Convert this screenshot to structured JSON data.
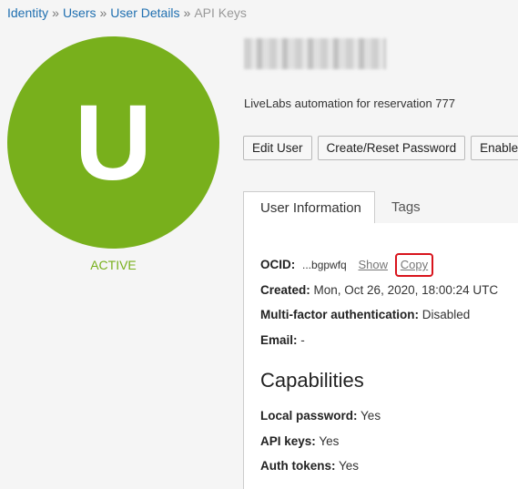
{
  "breadcrumb": {
    "items": [
      "Identity",
      "Users",
      "User Details"
    ],
    "current": "API Keys",
    "separator": "»"
  },
  "user": {
    "initial": "U",
    "status": "ACTIVE",
    "description": "LiveLabs automation for reservation 777"
  },
  "actions": {
    "edit_user": "Edit User",
    "reset_password": "Create/Reset Password",
    "enable": "Enable M"
  },
  "tabs": {
    "user_information": "User Information",
    "tags": "Tags"
  },
  "info": {
    "ocid_label": "OCID:",
    "ocid_value": "...bgpwfq",
    "show_link": "Show",
    "copy_link": "Copy",
    "created_label": "Created:",
    "created_value": "Mon, Oct 26, 2020, 18:00:24 UTC",
    "mfa_label": "Multi-factor authentication:",
    "mfa_value": "Disabled",
    "email_label": "Email:",
    "email_value": "-"
  },
  "capabilities": {
    "title": "Capabilities",
    "local_password_label": "Local password:",
    "local_password_value": "Yes",
    "api_keys_label": "API keys:",
    "api_keys_value": "Yes",
    "auth_tokens_label": "Auth tokens:",
    "auth_tokens_value": "Yes"
  },
  "colors": {
    "accent": "#78b01c",
    "link": "#1f6fb0",
    "highlight": "#d8141c"
  }
}
